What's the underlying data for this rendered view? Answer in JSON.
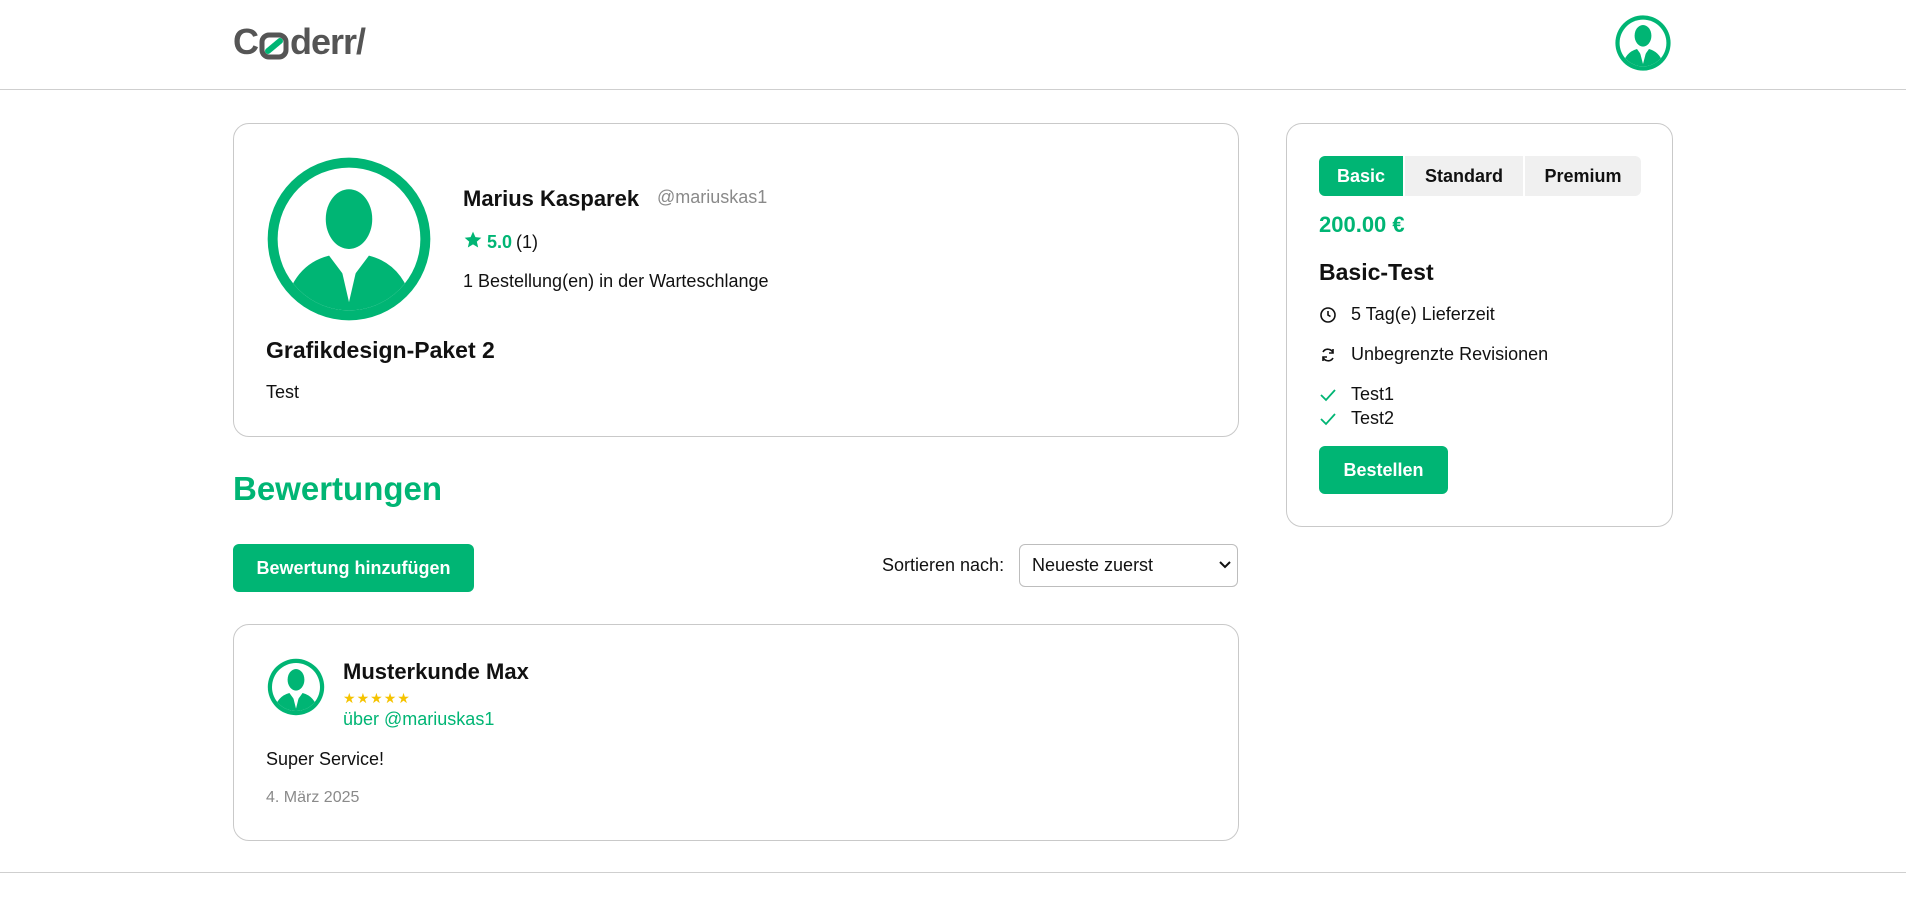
{
  "header": {
    "logo_text_1": "C",
    "logo_text_2": "derr/",
    "logo_icon": "logo-o-mark",
    "avatar_icon": "user-avatar-icon"
  },
  "offer": {
    "seller_name": "Marius Kasparek",
    "seller_handle": "@mariuskas1",
    "rating_value": "5.0",
    "rating_count": "(1)",
    "queue_text": "1 Bestellung(en) in der Warteschlange",
    "title": "Grafikdesign-Paket 2",
    "description": "Test"
  },
  "reviews": {
    "heading": "Bewertungen",
    "add_button": "Bewertung hinzufügen",
    "sort_label": "Sortieren nach:",
    "sort_selected": "Neueste zuerst",
    "items": [
      {
        "reviewer": "Musterkunde Max",
        "stars": 5,
        "about": "über @mariuskas1",
        "text": "Super Service!",
        "date": "4. März 2025"
      }
    ]
  },
  "package": {
    "tabs": [
      "Basic",
      "Standard",
      "Premium"
    ],
    "active_tab": "Basic",
    "price": "200.00 €",
    "title": "Basic-Test",
    "delivery": "5 Tag(e) Lieferzeit",
    "revisions": "Unbegrenzte Revisionen",
    "features": [
      "Test1",
      "Test2"
    ],
    "order_button": "Bestellen"
  },
  "colors": {
    "accent": "#00b574",
    "star": "#f5c300",
    "muted": "#8a8a8a"
  }
}
